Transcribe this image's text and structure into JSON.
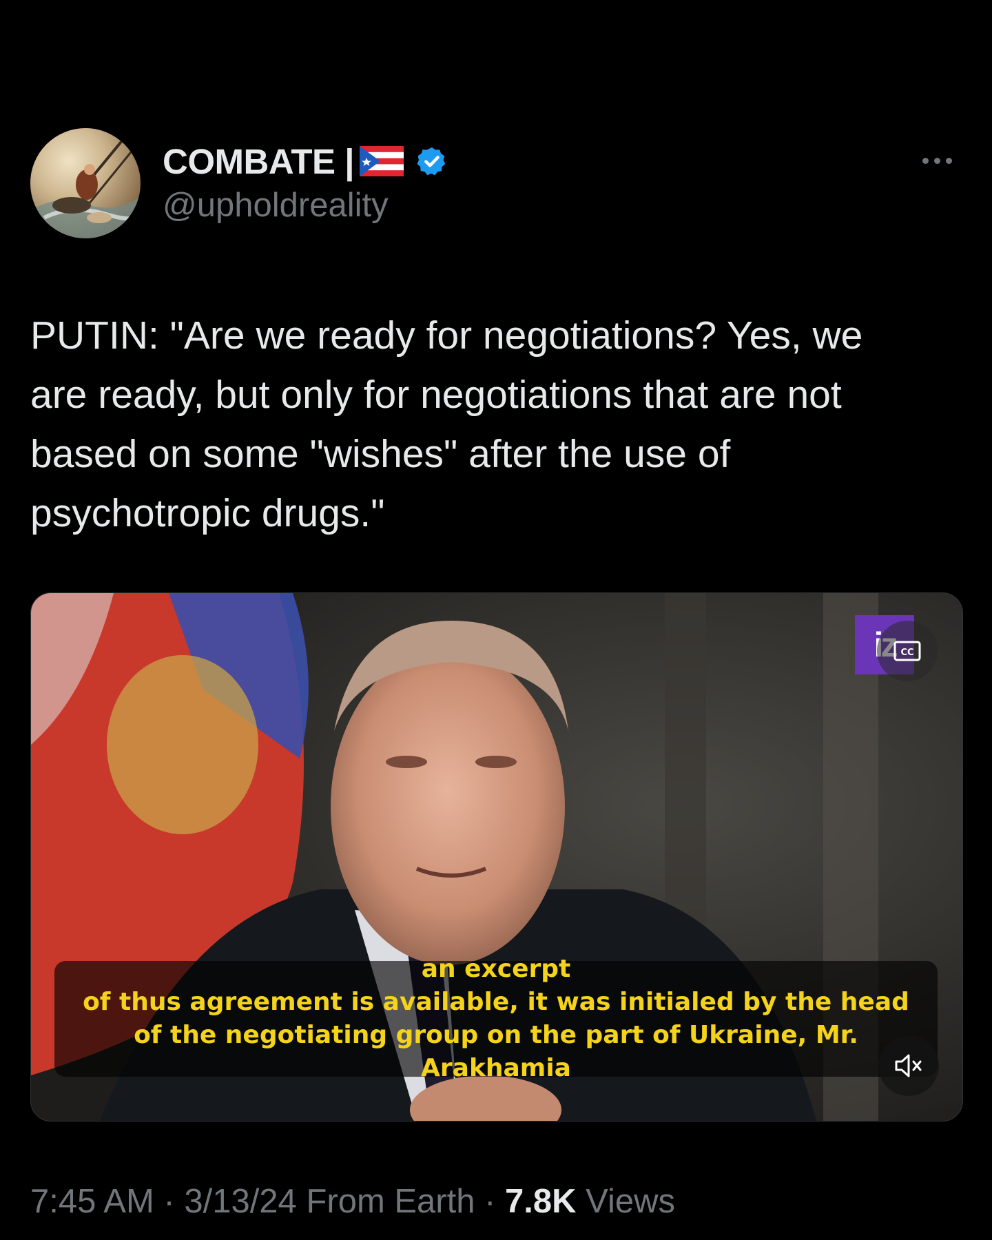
{
  "author": {
    "display_name": "COMBATE |",
    "handle": "@upholdreality",
    "flag_icon": "puerto-rico-flag",
    "verified_icon": "verified-badge-icon",
    "verified_color": "#1d9bf0"
  },
  "tweet": {
    "text": "PUTIN: \"Are we ready for negotiations? Yes, we\nare ready, but only for negotiations that are not\nbased on some \"wishes\" after the use of\npsychotropic drugs.\""
  },
  "media": {
    "logo_text": "iz",
    "subtitle_lines": [
      "an excerpt",
      "of thus agreement is available, it was initialed by the head",
      "of the negotiating group on the part of Ukraine, Mr. Arakhamia"
    ],
    "subtitle_color": "#f5d31b"
  },
  "meta": {
    "time": "7:45 AM",
    "sep1": " · ",
    "date": "3/13/24",
    "source": " From Earth",
    "sep2": " · ",
    "views_count": "7.8K",
    "views_label": " Views"
  },
  "colors": {
    "background": "#000000",
    "text": "#e7e9ea",
    "secondary": "#71767b"
  }
}
